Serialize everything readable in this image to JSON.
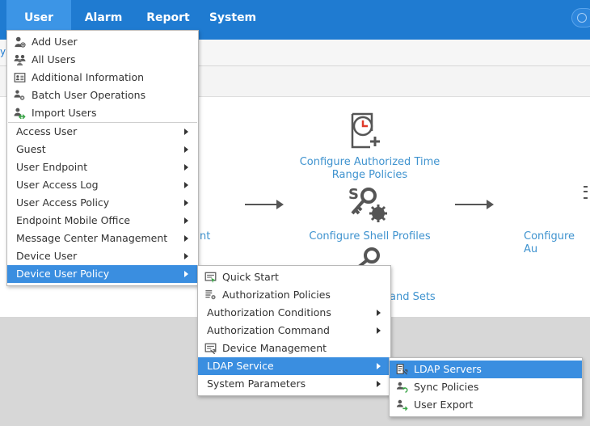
{
  "topnav": {
    "items": [
      {
        "label": "User",
        "active": true
      },
      {
        "label": "Alarm",
        "active": false
      },
      {
        "label": "Report",
        "active": false
      },
      {
        "label": "System",
        "active": false
      }
    ]
  },
  "workflow": {
    "left_fragment": "nt",
    "authorized_time": "Configure Authorized Time Range Policies",
    "shell_profiles": "Configure Shell Profiles",
    "command_sets_fragment": "and Sets",
    "right_fragment": "Configure Au"
  },
  "user_menu": {
    "icon_items": [
      {
        "label": "Add User",
        "icon": "add-user-icon"
      },
      {
        "label": "All Users",
        "icon": "all-users-icon"
      },
      {
        "label": "Additional Information",
        "icon": "id-card-icon"
      },
      {
        "label": "Batch User Operations",
        "icon": "batch-users-icon"
      },
      {
        "label": "Import Users",
        "icon": "import-users-icon"
      }
    ],
    "submenu_items": [
      {
        "label": "Access User"
      },
      {
        "label": "Guest"
      },
      {
        "label": "User Endpoint"
      },
      {
        "label": "User Access Log"
      },
      {
        "label": "User Access Policy"
      },
      {
        "label": "Endpoint Mobile Office"
      },
      {
        "label": "Message Center Management"
      },
      {
        "label": "Device User"
      },
      {
        "label": "Device User Policy",
        "selected": true
      }
    ]
  },
  "device_user_policy_menu": {
    "items": [
      {
        "label": "Quick Start",
        "icon": "quick-start-icon",
        "submenu": false
      },
      {
        "label": "Authorization Policies",
        "icon": "authorization-policies-icon",
        "submenu": false
      },
      {
        "label": "Authorization Conditions",
        "submenu": true
      },
      {
        "label": "Authorization Command",
        "submenu": true
      },
      {
        "label": "Device Management",
        "icon": "device-management-icon",
        "submenu": false
      },
      {
        "label": "LDAP Service",
        "submenu": true,
        "selected": true
      },
      {
        "label": "System Parameters",
        "submenu": true
      }
    ]
  },
  "ldap_menu": {
    "items": [
      {
        "label": "LDAP Servers",
        "icon": "ldap-servers-icon",
        "selected": true
      },
      {
        "label": "Sync Policies",
        "icon": "sync-policies-icon"
      },
      {
        "label": "User Export",
        "icon": "user-export-icon"
      }
    ]
  },
  "colors": {
    "topbar": "#1f7bd1",
    "active_tab": "#3c95e6",
    "menu_selected": "#3a8ee0",
    "link": "#3f93cf",
    "accent_red": "#e03a2a"
  }
}
